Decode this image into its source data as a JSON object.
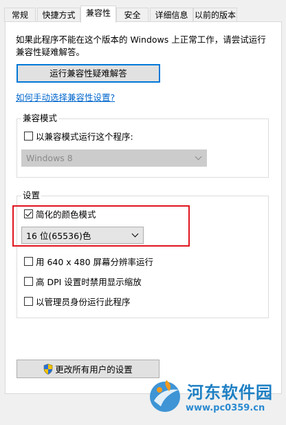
{
  "tabs": [
    {
      "label": "常规"
    },
    {
      "label": "快捷方式"
    },
    {
      "label": "兼容性",
      "active": true
    },
    {
      "label": "安全"
    },
    {
      "label": "详细信息"
    },
    {
      "label": "以前的版本"
    }
  ],
  "intro_text": "如果此程序不能在这个版本的 Windows 上正常工作，请尝试运行兼容性疑难解答。",
  "troubleshoot_button": "运行兼容性疑难解答",
  "manual_link": "如何手动选择兼容性设置?",
  "compat_mode": {
    "title": "兼容模式",
    "checkbox_label": "以兼容模式运行这个程序:",
    "checked": false,
    "os_select": "Windows 8"
  },
  "settings": {
    "title": "设置",
    "reduced_color": {
      "label": "简化的颜色模式",
      "checked": true
    },
    "color_select": "16 位(65536)色",
    "options": [
      {
        "label": "用 640 x 480 屏幕分辨率运行",
        "checked": false
      },
      {
        "label": "高 DPI 设置时禁用显示缩放",
        "checked": false
      },
      {
        "label": "以管理员身份运行此程序",
        "checked": false
      }
    ]
  },
  "all_users_button": "更改所有用户的设置",
  "watermark": {
    "title": "河东软件园",
    "url": "www.pc0359.cn"
  },
  "colors": {
    "highlight": "#e0141e",
    "link": "#0066cc",
    "focus": "#0078d7"
  }
}
